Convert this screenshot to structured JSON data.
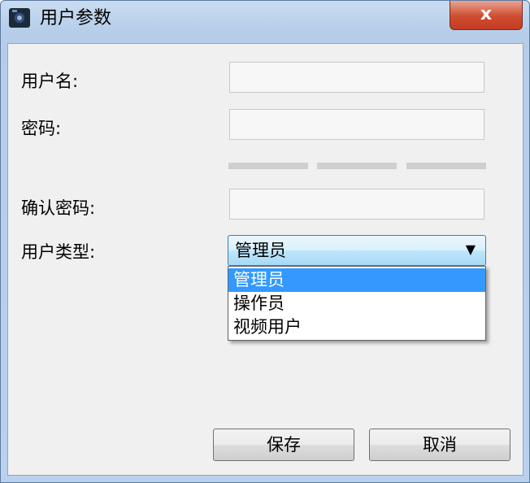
{
  "window": {
    "title": "用户参数",
    "close_symbol": "x"
  },
  "form": {
    "username_label": "用户名:",
    "password_label": "密码:",
    "confirm_label": "确认密码:",
    "usertype_label": "用户类型:",
    "username_value": "",
    "password_value": "",
    "confirm_value": ""
  },
  "usertype": {
    "selected": "管理员",
    "arrow": "▼",
    "options": [
      "管理员",
      "操作员",
      "视频用户"
    ],
    "highlighted_index": 0
  },
  "password_strength": {
    "segments": 3,
    "level": 0
  },
  "buttons": {
    "save_label": "保存",
    "cancel_label": "取消"
  },
  "colors": {
    "highlight": "#3399ff",
    "close": "#c43c23",
    "titlebar": "#c9dcf1"
  }
}
